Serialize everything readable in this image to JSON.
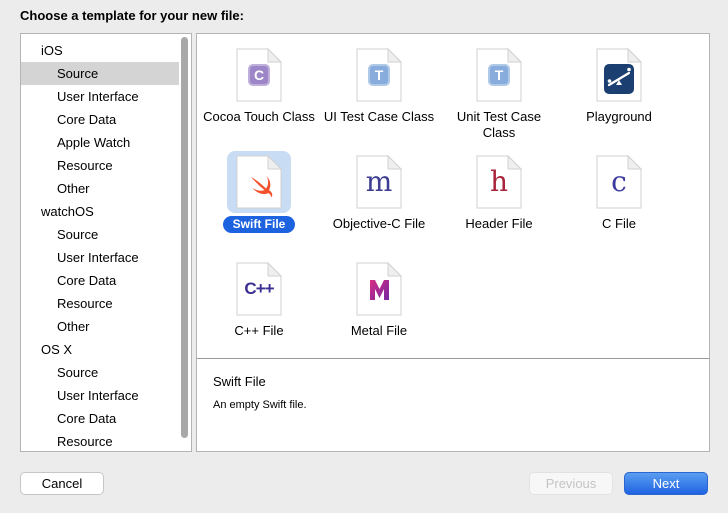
{
  "window": {
    "title": "Choose a template for your new file:"
  },
  "sidebar": {
    "sections": [
      {
        "header": "iOS",
        "items": [
          "Source",
          "User Interface",
          "Core Data",
          "Apple Watch",
          "Resource",
          "Other"
        ]
      },
      {
        "header": "watchOS",
        "items": [
          "Source",
          "User Interface",
          "Core Data",
          "Resource",
          "Other"
        ]
      },
      {
        "header": "OS X",
        "items": [
          "Source",
          "User Interface",
          "Core Data",
          "Resource"
        ]
      }
    ],
    "selected": {
      "section": "iOS",
      "item": "Source"
    },
    "selected_bg": "#d4d4d4"
  },
  "templates": [
    {
      "label": "Cocoa Touch Class",
      "icon": "badge",
      "badge_text": "C",
      "color": "#9d86c8",
      "selected": false
    },
    {
      "label": "UI Test Case Class",
      "icon": "badge",
      "badge_text": "T",
      "color": "#88acdc",
      "selected": false
    },
    {
      "label": "Unit Test Case Class",
      "icon": "badge",
      "badge_text": "T",
      "color": "#88acdc",
      "selected": false
    },
    {
      "label": "Playground",
      "icon": "playground",
      "color": "#1c3f72",
      "selected": false
    },
    {
      "label": "Swift File",
      "icon": "swift",
      "color": "#f3502c",
      "selected": true
    },
    {
      "label": "Objective-C File",
      "icon": "serif",
      "letter": "m",
      "color": "#3d3d91",
      "selected": false
    },
    {
      "label": "Header File",
      "icon": "serif",
      "letter": "h",
      "color": "#a8253c",
      "selected": false
    },
    {
      "label": "C File",
      "icon": "serif",
      "letter": "c",
      "color": "#3c3c9e",
      "selected": false
    },
    {
      "label": "C++ File",
      "icon": "cpp",
      "letter": "C++",
      "color": "#3b2f91",
      "selected": false
    },
    {
      "label": "Metal File",
      "icon": "metal",
      "color_from": "#d82e83",
      "color_to": "#7527a0",
      "selected": false
    }
  ],
  "selection_style": {
    "icon_bg": "#c8dcf4",
    "pill_bg": "#1d63e0",
    "pill_text": "#ffffff"
  },
  "description": {
    "title": "Swift File",
    "body": "An empty Swift file."
  },
  "footer": {
    "cancel_label": "Cancel",
    "previous_label": "Previous",
    "next_label": "Next"
  },
  "accent_color": "#1f63e2"
}
